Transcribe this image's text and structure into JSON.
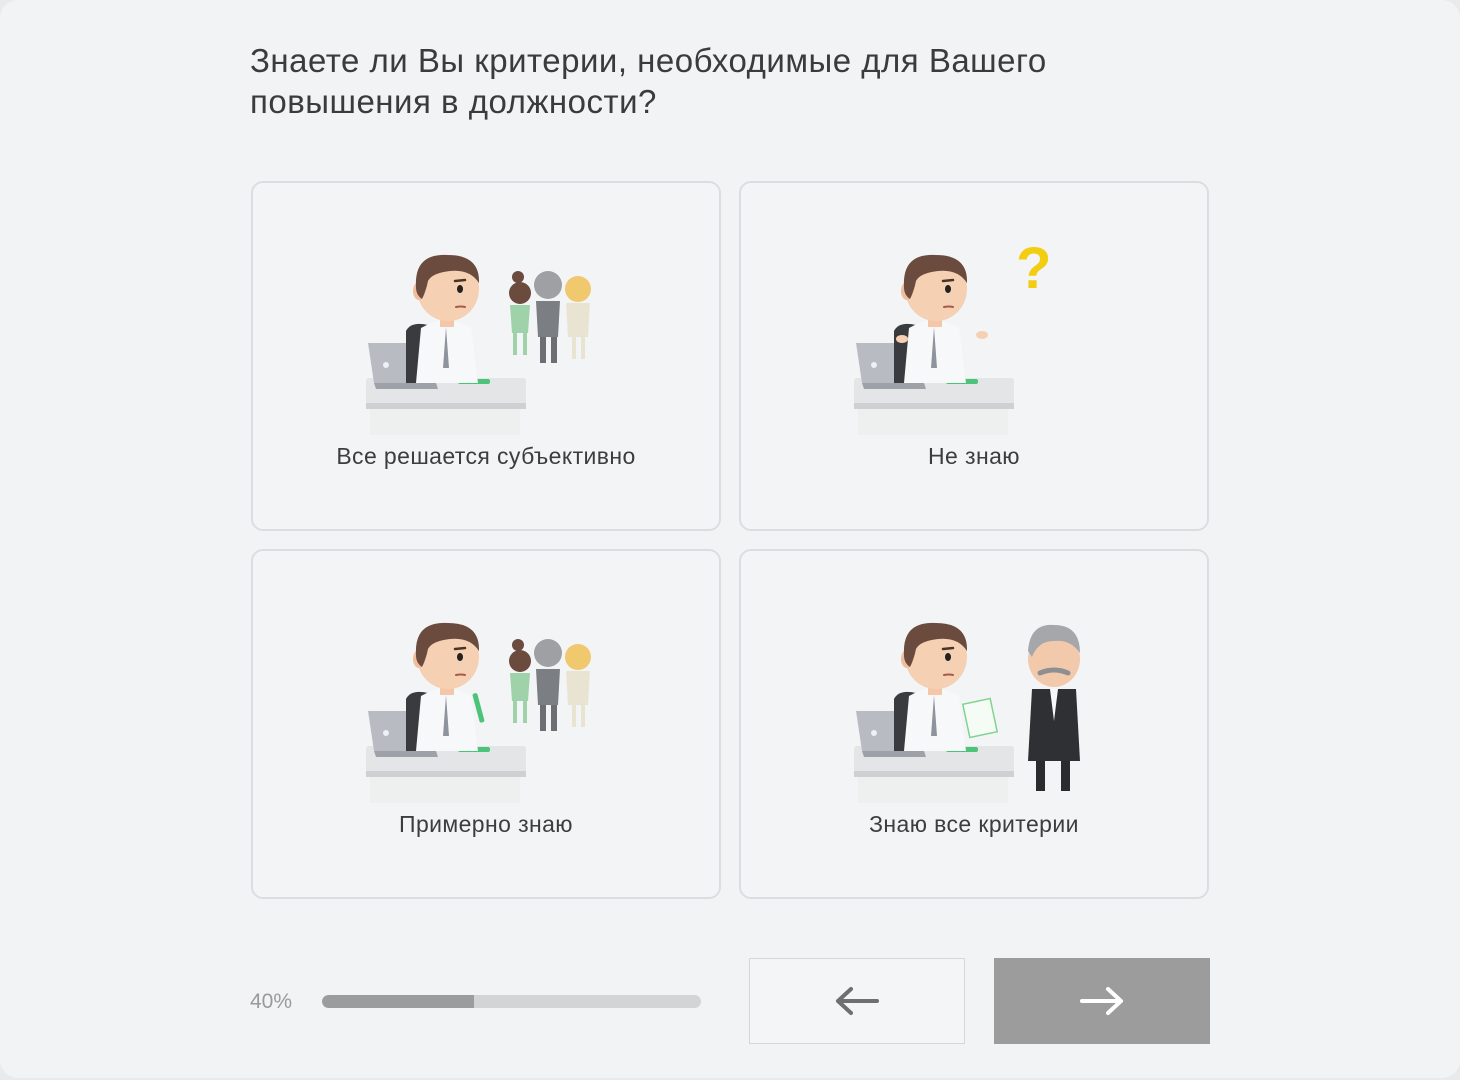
{
  "question": "Знаете ли Вы критерии, необходимые для Вашего повышения в должности?",
  "options": [
    {
      "label": "Все решается субъективно",
      "illustration": "employee-at-desk-with-colleagues"
    },
    {
      "label": "Не знаю",
      "illustration": "confused-employee-question-mark"
    },
    {
      "label": "Примерно знаю",
      "illustration": "employee-with-pen-and-colleagues"
    },
    {
      "label": "Знаю все критерии",
      "illustration": "employee-handing-document-to-boss"
    }
  ],
  "progress": {
    "label": "40%",
    "value": 0.4
  },
  "navigation": {
    "back_icon": "arrow-left-icon",
    "next_icon": "arrow-right-icon"
  },
  "colors": {
    "accent_yellow": "#f3cd12",
    "progress_fill": "#9b9c9e",
    "next_button": "#9c9c9c"
  }
}
